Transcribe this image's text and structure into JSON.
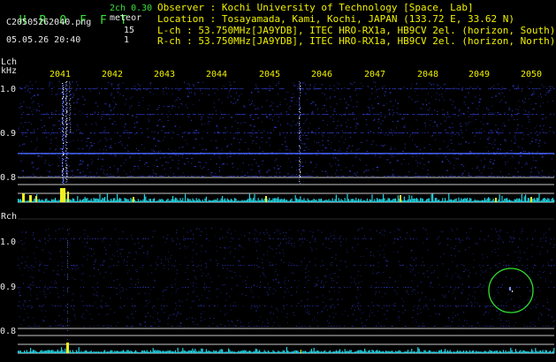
{
  "header": {
    "logo_letters": [
      "H",
      "R",
      "O",
      "F",
      "F",
      "T"
    ],
    "filename": "C20505262040.png",
    "datetime": "05.05.26 20:40",
    "mode": "2ch 0.30",
    "meteor_label": "meteor",
    "meteor_count_lch": "15",
    "meteor_count_rch": "1",
    "observer": "Observer : Kochi University of Technology [Space, Lab]",
    "location": "Location : Tosayamada, Kami, Kochi, JAPAN (133.72 E, 33.62 N)",
    "lch_info": "L-ch : 53.750MHz[JA9YDB], ITEC HRO-RX1a, HB9CV 2el. (horizon, South)",
    "rch_info": "R-ch : 53.750MHz[JA9YDB], ITEC HRO-RX1a, HB9CV 2el. (horizon, North)"
  },
  "time_axis": [
    "2041",
    "2042",
    "2043",
    "2044",
    "2045",
    "2046",
    "2047",
    "2048",
    "2049",
    "2050"
  ],
  "lch": {
    "label": "Lch",
    "unit": "kHz",
    "ticks": [
      "1.0",
      "0.9",
      "0.8"
    ]
  },
  "rch": {
    "label": "Rch",
    "ticks": [
      "1.0",
      "0.9",
      "0.8"
    ]
  },
  "colors": {
    "text_green": "#38e038",
    "text_yellow": "#f0f000",
    "text_white": "#e8e8e8",
    "signal_blue": "#3a4aff",
    "echo_white": "#ffffff",
    "level_cyan": "#20e0f0",
    "level_yellow": "#f0f020",
    "marker_circle": "#30e030",
    "grid_line": "#c8c8c8"
  }
}
